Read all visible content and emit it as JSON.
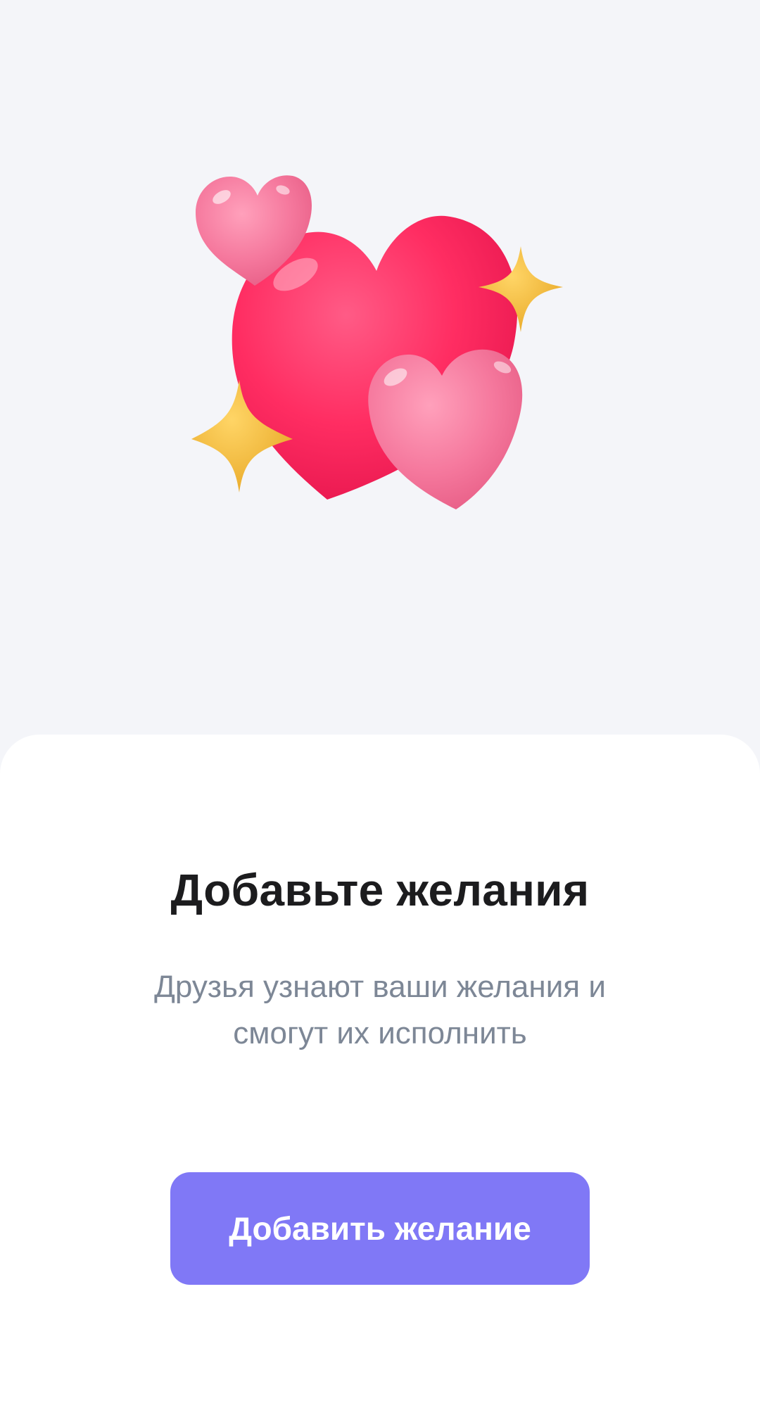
{
  "empty_state": {
    "illustration": "hearts-with-sparkles-icon",
    "title": "Добавьте желания",
    "subtitle_line1": "Друзья узнают ваши желания и",
    "subtitle_line2": "смогут их исполнить",
    "button_label": "Добавить желание"
  },
  "colors": {
    "background": "#f4f5f9",
    "sheet": "#ffffff",
    "title": "#1c1c1e",
    "subtitle": "#7d8796",
    "button": "#8078f6",
    "button_text": "#ffffff",
    "heart_main": "#ff2f66",
    "heart_pink": "#f6799e",
    "sparkle": "#f2bb3c"
  }
}
